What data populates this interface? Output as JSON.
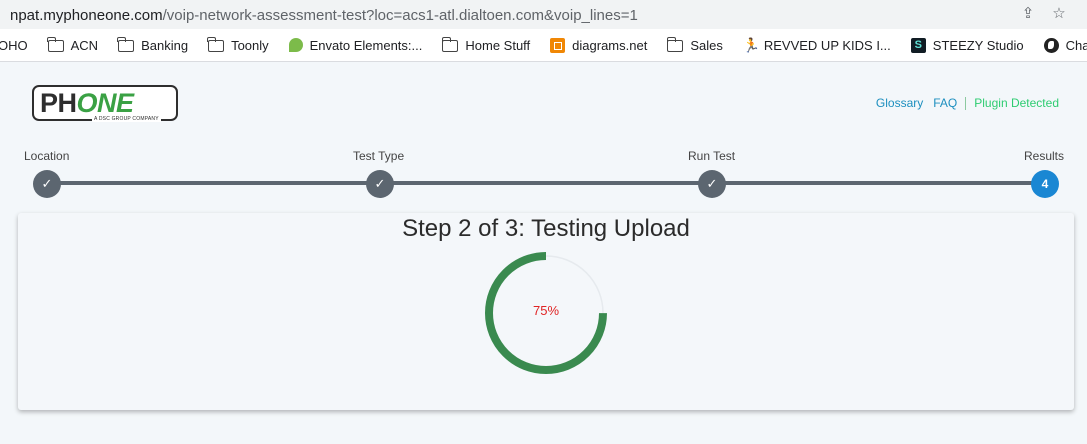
{
  "browser": {
    "url_host": "npat.myphoneone.com",
    "url_path": "/voip-network-assessment-test?loc=acs1-atl.dialtoen.com&voip_lines=1",
    "share_icon": "share-icon",
    "star_icon": "star-icon",
    "bookmarks": [
      {
        "label": "OHO",
        "icon": "none"
      },
      {
        "label": "ACN",
        "icon": "folder-icon"
      },
      {
        "label": "Banking",
        "icon": "folder-icon"
      },
      {
        "label": "Toonly",
        "icon": "folder-icon"
      },
      {
        "label": "Envato Elements:...",
        "icon": "envato-leaf-icon"
      },
      {
        "label": "Home Stuff",
        "icon": "folder-icon"
      },
      {
        "label": "diagrams.net",
        "icon": "diagrams-icon"
      },
      {
        "label": "Sales",
        "icon": "folder-icon"
      },
      {
        "label": "REVVED UP KIDS I...",
        "icon": "runner-icon"
      },
      {
        "label": "STEEZY Studio",
        "icon": "steezy-icon"
      },
      {
        "label": "CharityNet US",
        "icon": "globe-icon"
      }
    ]
  },
  "header": {
    "logo_ph": "PH",
    "logo_one": "ONE",
    "logo_tagline": "A DSC GROUP COMPANY",
    "links": {
      "glossary": "Glossary",
      "faq": "FAQ",
      "plugin": "Plugin Detected"
    },
    "colors": {
      "link": "#1d8fbf",
      "plugin": "#2ecc71"
    }
  },
  "stepper": {
    "steps": [
      {
        "label": "Location",
        "state": "done",
        "mark": "✓"
      },
      {
        "label": "Test Type",
        "state": "done",
        "mark": "✓"
      },
      {
        "label": "Run Test",
        "state": "done",
        "mark": "✓"
      },
      {
        "label": "Results",
        "state": "active",
        "mark": "4"
      }
    ],
    "colors": {
      "done": "#5c6670",
      "active": "#1a87d3"
    }
  },
  "test": {
    "title": "Step 2 of 3: Testing Upload",
    "progress_percent": 75,
    "progress_label": "75%",
    "colors": {
      "ring": "#3a8a4f",
      "track": "#e6eaee",
      "label": "#e02424"
    }
  }
}
